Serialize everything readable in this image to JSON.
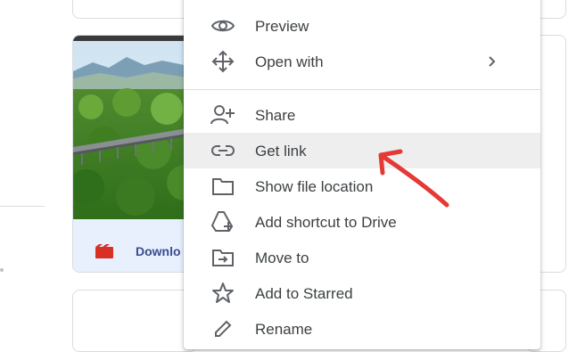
{
  "files": {
    "video_card": {
      "name": "Downlo",
      "icon": "film-icon"
    }
  },
  "context_menu": {
    "items": [
      {
        "label": "Preview",
        "icon": "eye-icon"
      },
      {
        "label": "Open with",
        "icon": "move-arrows-icon",
        "submenu": true
      },
      {
        "label": "Share",
        "icon": "person-add-icon"
      },
      {
        "label": "Get link",
        "icon": "link-icon",
        "highlighted": true
      },
      {
        "label": "Show file location",
        "icon": "folder-icon"
      },
      {
        "label": "Add shortcut to Drive",
        "icon": "drive-shortcut-icon"
      },
      {
        "label": "Move to",
        "icon": "folder-move-icon"
      },
      {
        "label": "Add to Starred",
        "icon": "star-icon"
      },
      {
        "label": "Rename",
        "icon": "pencil-icon"
      }
    ]
  },
  "annotation": {
    "arrow_color": "#e53935",
    "points_to": "Get link"
  },
  "colors": {
    "video_icon": "#d93025",
    "video_name": "#3c4a8f",
    "footer_bg": "#e8f0fe",
    "highlight": "#eeeeee"
  }
}
